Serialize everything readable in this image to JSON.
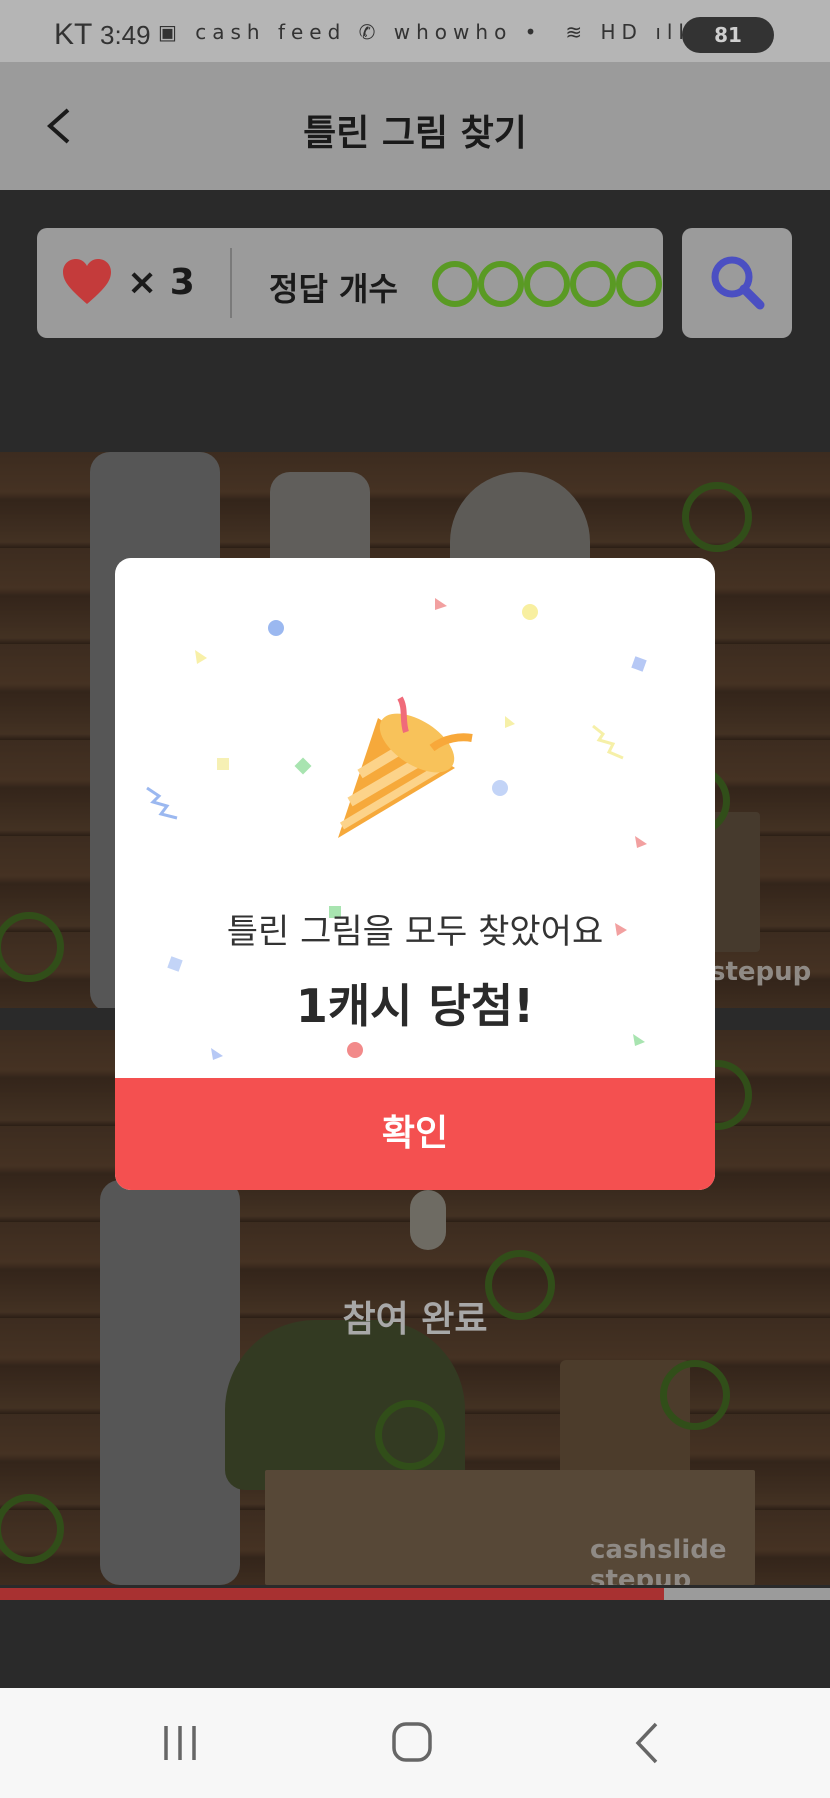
{
  "status_bar": {
    "carrier": "KT",
    "time": "3:49",
    "left_icons": "▣ cash feed ✆ whowho •",
    "right_icons": "≋ HD ıll",
    "battery": "81"
  },
  "header": {
    "title": "틀린 그림 찾기",
    "back_icon": "chevron-left-icon"
  },
  "game": {
    "lives_text": "× 3",
    "correct_label": "정답 개수",
    "correct_count": 5,
    "search_icon": "magnifier-icon"
  },
  "picture": {
    "watermark_top": "stepup",
    "watermark_bottom": "cashslide stepup",
    "done_label": "참여 완료"
  },
  "progress": {
    "fraction": 0.8
  },
  "modal": {
    "message": "틀린 그림을 모두 찾았어요",
    "prize": "1캐시 당첨!",
    "confirm_label": "확인",
    "illustration": "party-popper-icon"
  },
  "navbar": {
    "recent_icon": "recent-apps-icon",
    "home_icon": "home-icon",
    "back_icon": "back-icon"
  },
  "colors": {
    "accent": "#f45050",
    "ring": "#5a9a24",
    "heart": "#c43b3b"
  }
}
